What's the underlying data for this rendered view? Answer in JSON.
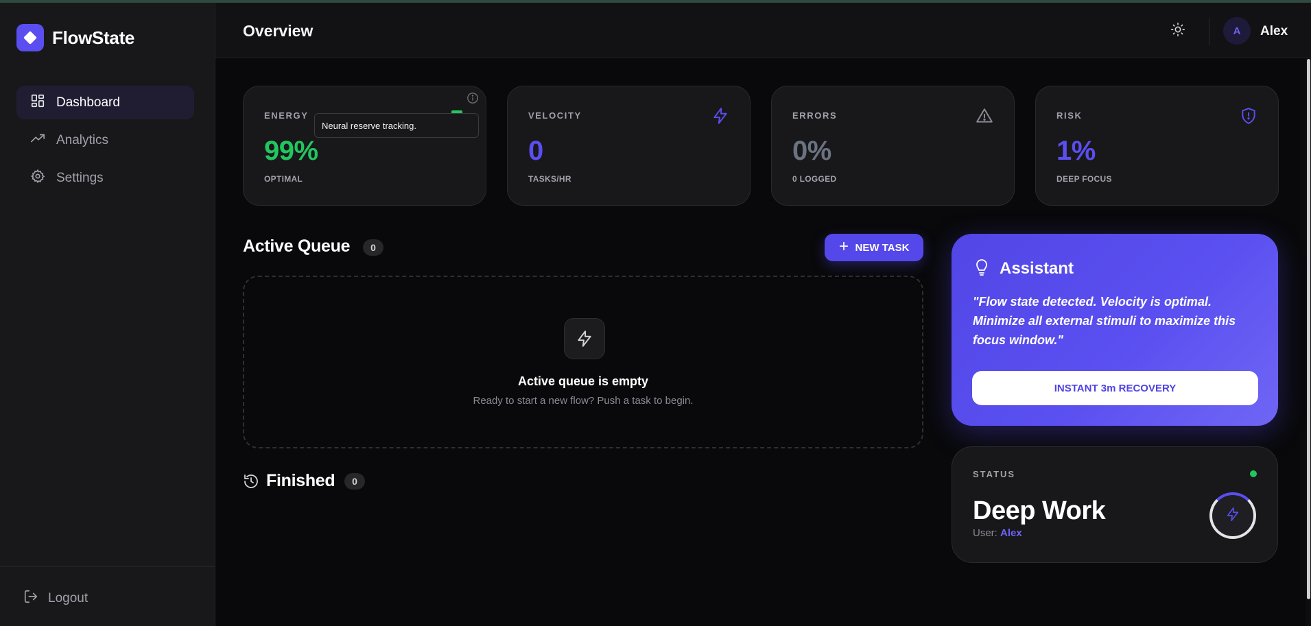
{
  "app": {
    "name": "FlowState"
  },
  "sidebar": {
    "items": [
      {
        "label": "Dashboard",
        "icon": "dashboard-icon",
        "active": true
      },
      {
        "label": "Analytics",
        "icon": "trending-up-icon",
        "active": false
      },
      {
        "label": "Settings",
        "icon": "gear-icon",
        "active": false
      }
    ],
    "logout_label": "Logout"
  },
  "header": {
    "title": "Overview",
    "user": {
      "initial": "A",
      "name": "Alex"
    }
  },
  "stats": [
    {
      "label": "ENERGY",
      "value": "99%",
      "sub": "OPTIMAL",
      "color": "#22c55e",
      "icon": "info-icon"
    },
    {
      "label": "VELOCITY",
      "value": "0",
      "sub": "TASKS/HR",
      "color": "#5b4ef0",
      "icon": "lightning-icon"
    },
    {
      "label": "ERRORS",
      "value": "0%",
      "sub": "0 LOGGED",
      "color": "#6b7280",
      "icon": "warning-icon"
    },
    {
      "label": "RISK",
      "value": "1%",
      "sub": "DEEP FOCUS",
      "color": "#5b4ef0",
      "icon": "shield-alert-icon"
    }
  ],
  "tooltip": {
    "text": "Neural reserve tracking."
  },
  "queue": {
    "title": "Active Queue",
    "count": "0",
    "new_task_label": "NEW TASK",
    "empty_title": "Active queue is empty",
    "empty_sub": "Ready to start a new flow? Push a task to begin."
  },
  "finished": {
    "title": "Finished",
    "count": "0"
  },
  "assistant": {
    "title": "Assistant",
    "quote": "\"Flow state detected. Velocity is optimal. Minimize all external stimuli to maximize this focus window.\"",
    "button_label": "INSTANT 3m RECOVERY"
  },
  "status": {
    "label": "STATUS",
    "title": "Deep Work",
    "user_prefix": "User:",
    "user_name": "Alex"
  },
  "colors": {
    "accent": "#5b4ef0",
    "success": "#22c55e"
  }
}
